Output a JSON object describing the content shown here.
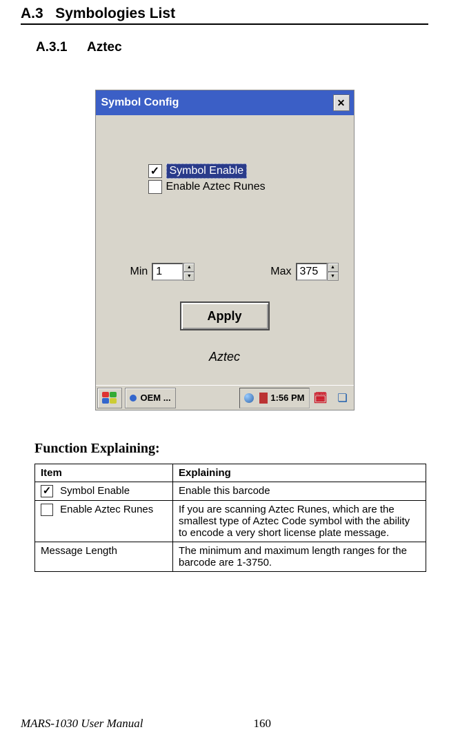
{
  "section": {
    "num": "A.3",
    "title": "Symbologies List"
  },
  "subsection": {
    "num": "A.3.1",
    "title": "Aztec"
  },
  "dialog": {
    "title": "Symbol Config",
    "opts": {
      "symbol_enable": "Symbol Enable",
      "enable_runes": "Enable Aztec Runes"
    },
    "min_label": "Min",
    "min_value": "1",
    "max_label": "Max",
    "max_value": "375",
    "apply": "Apply",
    "panel_name": "Aztec",
    "taskbar": {
      "app": "OEM ...",
      "time": "1:56 PM"
    }
  },
  "func_heading": "Function Explaining:",
  "table": {
    "head": {
      "item": "Item",
      "explain": "Explaining"
    },
    "rows": [
      {
        "icon": "check",
        "item": "Symbol Enable",
        "explain": "Enable this barcode"
      },
      {
        "icon": "box",
        "item": "Enable Aztec Runes",
        "explain": "If you are scanning Aztec Runes, which are the smallest type of Aztec Code symbol with the ability to encode a very short license plate message."
      },
      {
        "icon": "",
        "item": "Message Length",
        "explain": "The minimum and maximum length ranges for the barcode are 1-3750."
      }
    ]
  },
  "footer": {
    "manual": "MARS-1030 User Manual",
    "page": "160"
  }
}
